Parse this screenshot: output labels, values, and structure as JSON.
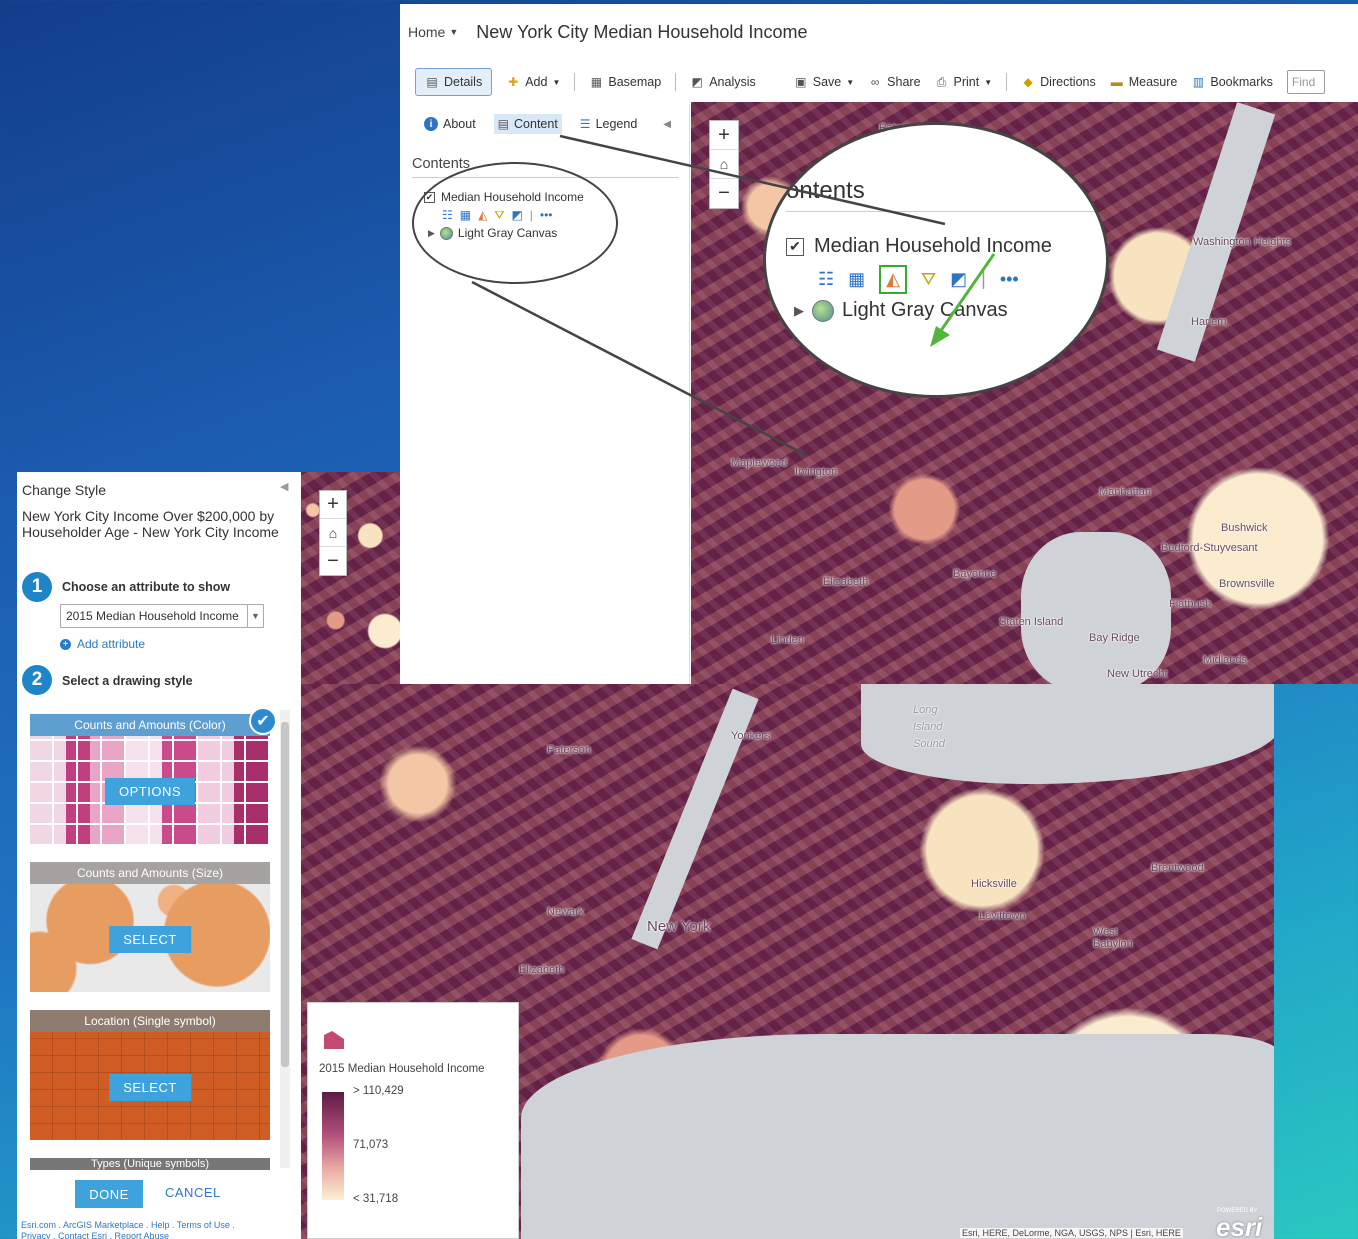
{
  "top_window": {
    "home": "Home",
    "title": "New York City Median Household Income",
    "toolbar": {
      "details": "Details",
      "add": "Add",
      "basemap": "Basemap",
      "analysis": "Analysis",
      "save": "Save",
      "share": "Share",
      "print": "Print",
      "directions": "Directions",
      "measure": "Measure",
      "bookmarks": "Bookmarks",
      "find_placeholder": "Find"
    },
    "pane_tabs": {
      "about": "About",
      "content": "Content",
      "legend": "Legend"
    },
    "contents_heading": "Contents",
    "layers": [
      {
        "name": "Median Household Income",
        "checked": true
      },
      {
        "name": "Light Gray Canvas"
      }
    ],
    "zoom_in": "+",
    "zoom_out": "−",
    "map_labels": [
      "Paterson",
      "Washington Heights",
      "Harlem",
      "Maplewood",
      "Irvington",
      "Manhattan",
      "Bushwick",
      "Bedford-Stuyvesant",
      "Brownsville",
      "Flatbush",
      "Elizabeth",
      "Bayonne",
      "Staten Island",
      "Bay Ridge",
      "Linden",
      "New Utrecht",
      "Midlands"
    ],
    "magnified": {
      "heading": "ontents",
      "layer": "Median Household Income",
      "basemap": "Light Gray Canvas"
    }
  },
  "style_panel": {
    "title": "Change Style",
    "layer_name": "New York City Income Over $200,000 by Householder Age - New York City Income",
    "step1_number": "1",
    "step1_label": "Choose an attribute to show",
    "attribute_value": "2015 Median Household Income",
    "add_attribute": "Add attribute",
    "step2_number": "2",
    "step2_label": "Select a drawing style",
    "cards": [
      {
        "title": "Counts and Amounts (Color)",
        "button": "OPTIONS",
        "selected": true
      },
      {
        "title": "Counts and Amounts (Size)",
        "button": "SELECT"
      },
      {
        "title": "Location (Single symbol)",
        "button": "SELECT"
      },
      {
        "title": "Types (Unique symbols)"
      }
    ],
    "done": "DONE",
    "cancel": "CANCEL",
    "footer_line1": "Esri.com . ArcGIS Marketplace . Help . Terms of Use .",
    "footer_line2": "Privacy . Contact Esri . Report Abuse"
  },
  "bottom_map": {
    "labels": [
      "Paterson",
      "Yonkers",
      "Long Island Sound",
      "Newark",
      "New York",
      "Elizabeth",
      "Hicksville",
      "Levittown",
      "West Babylon",
      "Brentwood"
    ],
    "legend": {
      "title": "2015 Median Household Income",
      "high": "> 110,429",
      "mid": "71,073",
      "low": "< 31,718"
    },
    "attribution": "Esri, HERE, DeLorme, NGA, USGS, NPS | Esri, HERE",
    "esri_powered": "POWERED BY",
    "esri_logo": "esri"
  },
  "colors": {
    "accent": "#3ea2dd",
    "step_badge": "#1e86c8",
    "link": "#2a7ac4",
    "highlight_box": "#3aa832"
  }
}
